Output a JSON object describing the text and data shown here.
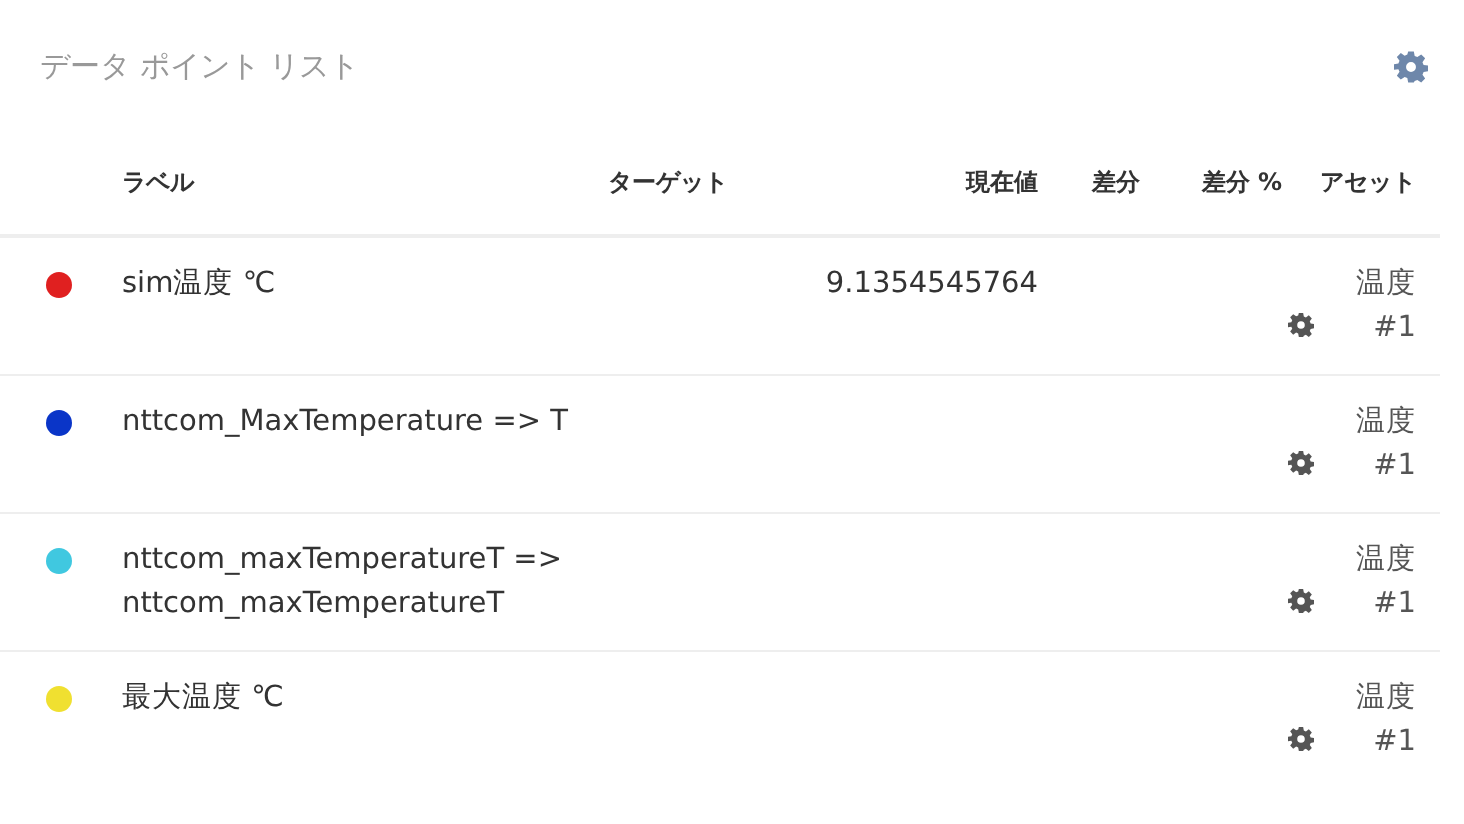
{
  "panel": {
    "title": "データ ポイント リスト"
  },
  "table": {
    "columns": [
      "ラベル",
      "ターゲット",
      "現在値",
      "差分",
      "差分 %",
      "アセット"
    ],
    "rows": [
      {
        "color": "#e02020",
        "label": "sim温度 ℃",
        "current": "9.1354545764",
        "asset": "温度 #1"
      },
      {
        "color": "#0a35c8",
        "label": "nttcom_MaxTemperature => T",
        "asset": "温度 #1"
      },
      {
        "color": "#40c8e0",
        "label": "nttcom_maxTemperatureT => nttcom_maxTemperatureT",
        "asset": "温度 #1"
      },
      {
        "color": "#f0e030",
        "label": "最大温度 ℃",
        "asset": "温度 #1"
      }
    ]
  }
}
